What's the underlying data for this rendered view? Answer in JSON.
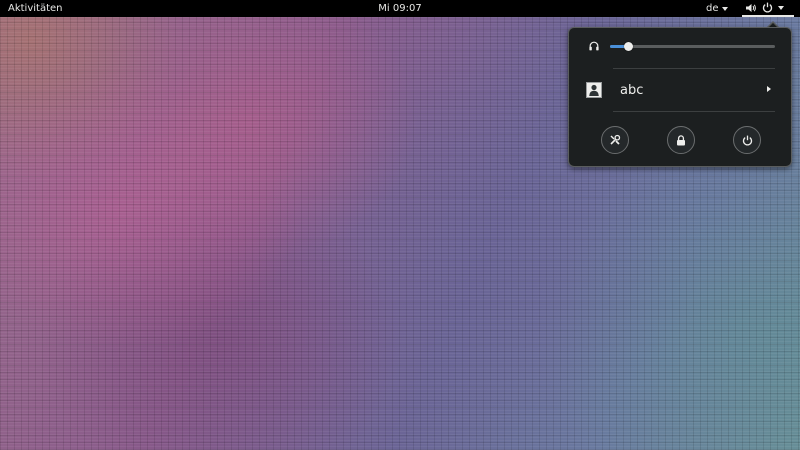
{
  "topbar": {
    "activities_label": "Aktivitäten",
    "clock": "Mi 09:07",
    "keyboard_layout": "de"
  },
  "system_menu": {
    "volume": {
      "icon": "headphones-icon",
      "level": 0.11
    },
    "user": {
      "name": "abc",
      "avatar_icon": "user-avatar-icon"
    },
    "buttons": [
      {
        "name": "settings-button",
        "icon": "settings-icon"
      },
      {
        "name": "lock-button",
        "icon": "lock-icon"
      },
      {
        "name": "power-off-button",
        "icon": "power-icon"
      }
    ]
  },
  "colors": {
    "topbar": "#000000",
    "popup_bg": "#1c1f20",
    "accent": "#4a90d9"
  }
}
